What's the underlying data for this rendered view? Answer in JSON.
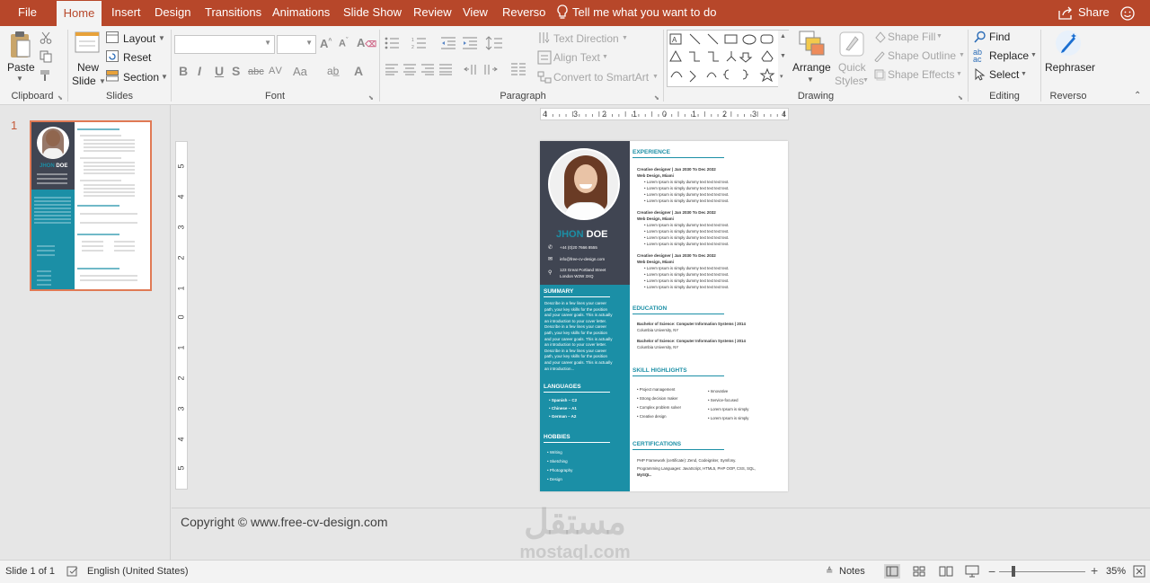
{
  "tabs": [
    "File",
    "Home",
    "Insert",
    "Design",
    "Transitions",
    "Animations",
    "Slide Show",
    "Review",
    "View",
    "Reverso"
  ],
  "tell_me": "Tell me what you want to do",
  "share": "Share",
  "ribbon": {
    "paste": "Paste",
    "clipboard": "Clipboard",
    "new_slide_1": "New",
    "new_slide_2": "Slide",
    "layout": "Layout",
    "reset": "Reset",
    "section": "Section",
    "slides": "Slides",
    "font": "Font",
    "paragraph": "Paragraph",
    "text_direction": "Text Direction",
    "align_text": "Align Text",
    "convert_smartart": "Convert to SmartArt",
    "arrange": "Arrange",
    "quick_styles_1": "Quick",
    "quick_styles_2": "Styles",
    "shape_fill": "Shape Fill",
    "shape_outline": "Shape Outline",
    "shape_effects": "Shape Effects",
    "drawing": "Drawing",
    "find": "Find",
    "replace": "Replace",
    "select": "Select",
    "editing": "Editing",
    "rephraser": "Rephraser",
    "reverso": "Reverso",
    "bold": "B",
    "italic": "I",
    "underline": "U",
    "strike": "S",
    "abc": "abc",
    "aa": "Aa"
  },
  "thumbnail_number": "1",
  "ruler_h": [
    "4",
    "3",
    "2",
    "1",
    "0",
    "1",
    "2",
    "3",
    "4"
  ],
  "ruler_v": [
    "5",
    "4",
    "3",
    "2",
    "1",
    "0",
    "1",
    "2",
    "3",
    "4",
    "5"
  ],
  "cv": {
    "name_first": "JHON",
    "name_last": "DOE",
    "phone": "+44 (0)20 7666 8555",
    "email": "info@free-cv-design.com",
    "address1": "123 Great Portland Street",
    "address2": "London W2W 3XQ",
    "summary_title": "SUMMARY",
    "summary_lines": [
      "Describe in a few lines your career",
      "path, your key skills for the position",
      "and your career goals. This is actually",
      "an introduction to your cover letter.",
      "Describe in a few lines your career",
      "path, your key skills for the position",
      "and your career goals. This is actually",
      "an introduction to your cover letter.",
      "Describe in a few lines your career",
      "path, your key skills for the position",
      "and your career goals. This is actually",
      "an introduction..."
    ],
    "languages_title": "LANGUAGES",
    "languages": [
      "Spanish – C2",
      "Chinese – A1",
      "German – A2"
    ],
    "hobbies_title": "HOBBIES",
    "hobbies": [
      "Writing",
      "Sketching",
      "Photography",
      "Design"
    ],
    "experience_title": "EXPERIENCE",
    "jobs": [
      {
        "role": "Creative designer | Jan 2030 To Dec 2032",
        "company": "Web Design, Miami"
      },
      {
        "role": "Creative designer | Jan 2030 To Dec 2032",
        "company": "Web Design, Miami"
      },
      {
        "role": "Creative designer | Jan 2030 To Dec 2032",
        "company": "Web Design, Miami"
      }
    ],
    "bullet": "Lorem Ipsum is simply dummy text text text text.",
    "education_title": "EDUCATION",
    "edu": [
      {
        "degree": "Bachelor of Science: Computer Information Systems | 2014",
        "school": "Columbia University, NY"
      },
      {
        "degree": "Bachelor of Science: Computer Information Systems | 2014",
        "school": "Columbia University, NY"
      }
    ],
    "skills_title": "SKILL HIGHLIGHTS",
    "skills_left": [
      "Project management",
      "Strong decision maker",
      "Complex problem solver",
      "Creative design"
    ],
    "skills_right": [
      "Innovative",
      "Service-focused",
      "Lorem Ipsum is simply",
      "Lorem Ipsum is simply"
    ],
    "cert_title": "CERTIFICATIONS",
    "cert1": "PHP Framework (certificate): Zend, Codeigniter, Symfony.",
    "cert2": "Programming Languages: JavaScript, HTML5, PHP OOP, CSS, SQL,",
    "cert3": "MySQL."
  },
  "notes_text": "Copyright © www.free-cv-design.com",
  "status": {
    "slide": "Slide 1 of 1",
    "language": "English (United States)",
    "notes": "Notes",
    "zoom": "35%"
  },
  "watermark": {
    "arabic": "مستقل",
    "latin": "mostaql.com"
  },
  "colors": {
    "accent": "#b7472a",
    "teal": "#1b8fa6",
    "dark": "#404552"
  }
}
